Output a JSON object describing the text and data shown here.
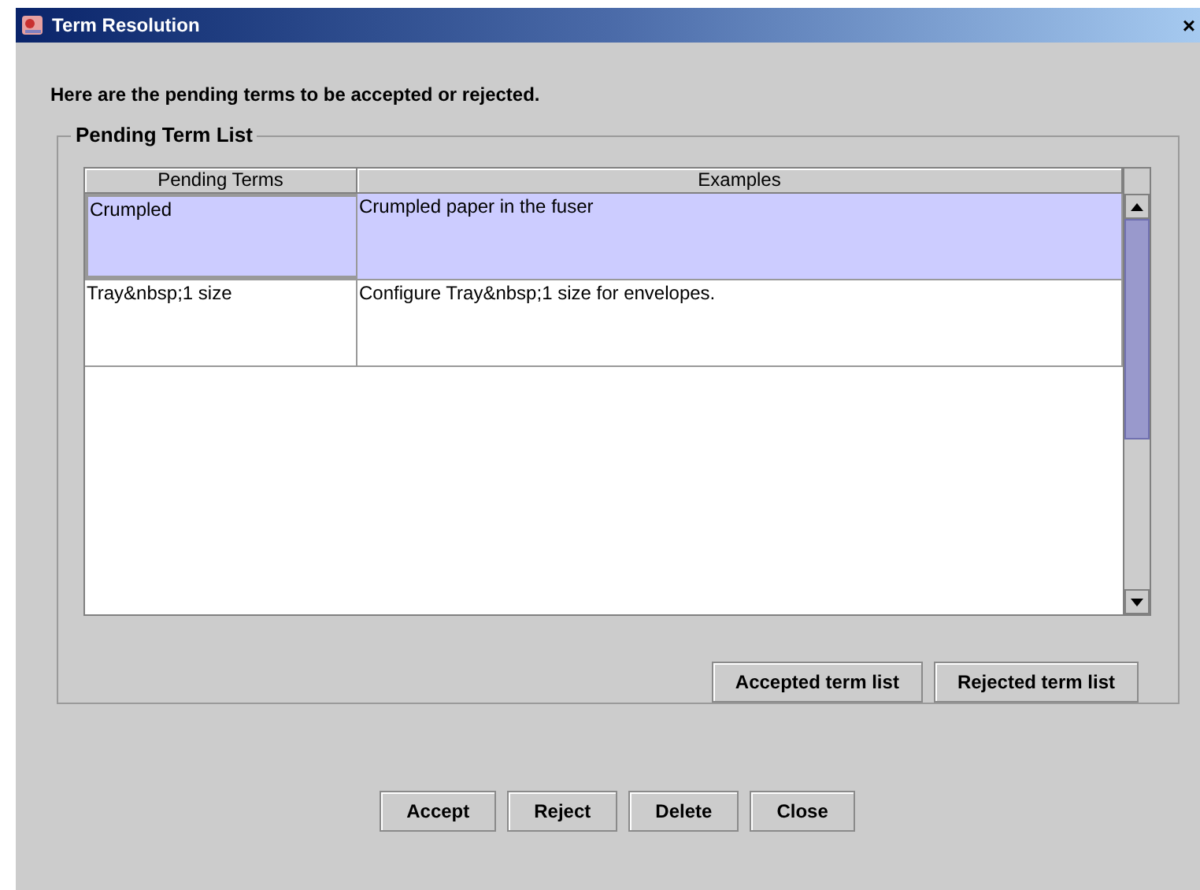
{
  "window": {
    "title": "Term Resolution",
    "close": "×"
  },
  "instruction": "Here are the pending terms to be accepted or rejected.",
  "group": {
    "title": "Pending Term List",
    "table": {
      "columns": [
        "Pending Terms",
        "Examples"
      ],
      "rows": [
        {
          "cells": [
            "Crumpled",
            "Crumpled paper in the fuser"
          ],
          "selected": true
        },
        {
          "cells": [
            "Tray&nbsp;1 size",
            "Configure Tray&nbsp;1 size for envelopes."
          ],
          "selected": false
        }
      ]
    },
    "buttons": [
      "Accepted term list",
      "Rejected term list"
    ]
  },
  "buttons": [
    "Accept",
    "Reject",
    "Delete",
    "Close"
  ]
}
